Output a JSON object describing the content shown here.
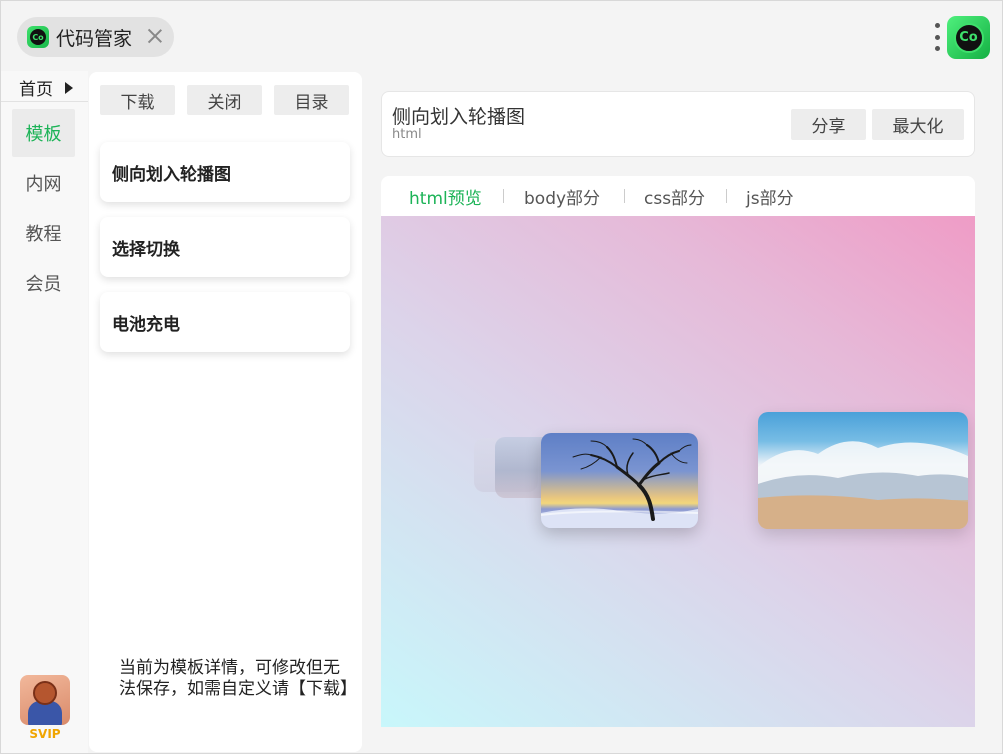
{
  "topbar": {
    "app_tab_title": "代码管家",
    "logo_text": "Co"
  },
  "leftnav": {
    "home_label": "首页",
    "items": [
      {
        "label": "模板",
        "active": true
      },
      {
        "label": "内网",
        "active": false
      },
      {
        "label": "教程",
        "active": false
      },
      {
        "label": "会员",
        "active": false
      }
    ],
    "svip_label": "SVIP"
  },
  "midpanel": {
    "buttons": {
      "download": "下载",
      "close": "关闭",
      "catalog": "目录"
    },
    "cards": [
      "侧向划入轮播图",
      "选择切换",
      "电池充电"
    ],
    "notice": "当前为模板详情，可修改但无法保存，如需自定义请【下载】"
  },
  "header": {
    "title": "侧向划入轮播图",
    "subtitle": "html",
    "share_label": "分享",
    "maximize_label": "最大化"
  },
  "preview": {
    "tabs": [
      {
        "label": "html预览",
        "active": true
      },
      {
        "label": "body部分",
        "active": false
      },
      {
        "label": "css部分",
        "active": false
      },
      {
        "label": "js部分",
        "active": false
      }
    ]
  },
  "colors": {
    "accent": "#1cb357",
    "svip": "#f0a500"
  }
}
